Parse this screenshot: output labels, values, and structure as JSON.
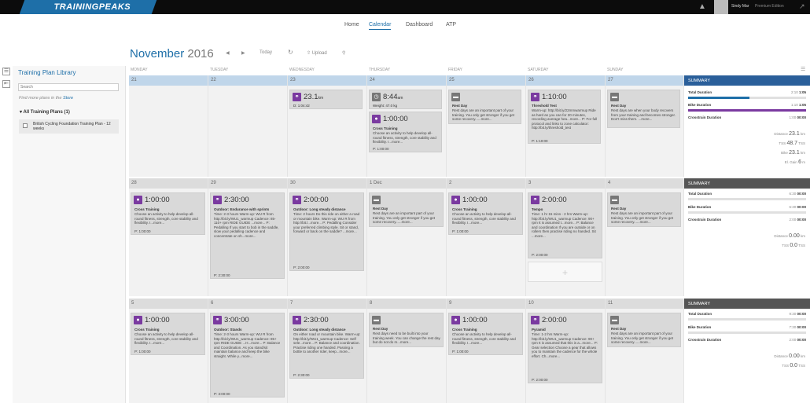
{
  "app": {
    "logo": "TRAININGPEAKS",
    "user": "Sindy Mar",
    "edition": "Premium Edition"
  },
  "nav": {
    "home": "Home",
    "calendar": "Calendar",
    "dashboard": "Dashboard",
    "atp": "ATP"
  },
  "header": {
    "month": "November",
    "year": "2016",
    "today": "Today",
    "upload": "Upload"
  },
  "library": {
    "title": "Training Plan Library",
    "search_placeholder": "Search",
    "find_text": "Find more plans in the ",
    "store_link": "Store",
    "all_plans": "All Training Plans (1)",
    "plan_name": "British Cycling Foundation Training Plan - 12 weeks"
  },
  "days": [
    "MONDAY",
    "TUESDAY",
    "WEDNESDAY",
    "THURSDAY",
    "FRIDAY",
    "SATURDAY",
    "SUNDAY"
  ],
  "weeks": [
    {
      "dates": [
        "21",
        "22",
        "23",
        "24",
        "25",
        "26",
        "27"
      ],
      "summary_title": "SUMMARY",
      "summary": {
        "total_label": "Total Duration",
        "total_val": "2:10",
        "total_plan": "1:05",
        "bike_label": "Bike Duration",
        "bike_val": "1:10",
        "bike_plan": "1:05",
        "cross_label": "Crosstrain Duration",
        "cross_val": "1:00",
        "cross_plan": "00:00",
        "distance_label": "Distance",
        "distance_val": "23.1",
        "distance_unit": "km",
        "tss_label": "TSS",
        "tss_val": "48.7",
        "tss_unit": "TSS",
        "bike_dist_label": "Bike",
        "bike_dist_val": "23.1",
        "bike_dist_unit": "km",
        "elev_label": "El. Gain",
        "elev_val": "6",
        "elev_unit": "m"
      },
      "cards": {
        "wed": {
          "dur": "23.1",
          "unit": "km",
          "sub": "D: 1:04:42"
        },
        "thu1": {
          "dur": "8:44",
          "unit": "am",
          "sub": "Weight: 47.0 kg"
        },
        "thu2": {
          "dur": "1:00:00",
          "title": "Cross Training",
          "desc": "Choose an activity to help develop all-round fitness, strength, core stability and flexibility. I...more...",
          "p": "P: 1:00:00"
        },
        "fri": {
          "title": "Rest Day",
          "desc": "Rest days are an important part of your training. You only get stronger if you get some recovery......more..."
        },
        "sat": {
          "dur": "1:10:00",
          "title": "Threshold Test",
          "desc": "Warm-up: http://bit.ly/22mmwarmup Ride as hard as you can for 20 minutes, recording average hea...more... P: For full protocol and links to zone calculator: http://bit.ly/threshold_test",
          "p": "P: 1:10:00"
        },
        "sun": {
          "title": "Rest Day",
          "desc": "Rest days are when your body recovers from your training and becomes stronger. Don't miss them. ...more..."
        }
      }
    },
    {
      "dates": [
        "28",
        "29",
        "30",
        "1 Dec",
        "2",
        "3",
        "4"
      ],
      "summary_title": "SUMMARY",
      "summary": {
        "total_label": "Total Duration",
        "total_val": "6:30",
        "total_plan": "00:00",
        "bike_label": "Bike Duration",
        "bike_val": "6:30",
        "bike_plan": "00:00",
        "cross_label": "Crosstrain Duration",
        "cross_val": "2:00",
        "cross_plan": "00:00",
        "distance_label": "Distance",
        "distance_val": "0.00",
        "distance_unit": "km",
        "tss_label": "TSS",
        "tss_val": "0.0",
        "tss_unit": "TSS"
      },
      "cards": {
        "mon": {
          "dur": "1:00:00",
          "title": "Cross Training",
          "desc": "Choose an activity to help develop all-round fitness, strength, core stability and flexibility. I...more...",
          "p": "P: 1:00:00"
        },
        "tue": {
          "dur": "2:30:00",
          "title": "Outdoor: Endurance with sprints",
          "desc": "Time: 2-3 hours Warm-up: WU R from http://bit.ly/WU1_warmup Cadence: 85-110+ rpm RIDE GUIDE ...more... P: Pedalling If you start to bob in the saddle, slow your pedalling cadence and concentrate on sh...more...",
          "p": "P: 2:30:00"
        },
        "wed": {
          "dur": "2:00:00",
          "title": "Outdoor: Long steady distance",
          "desc": "Time: 2 hours Do this ride on either a road or mountain bike. Warm-up: WU R from http://bit.l...more... P: Pedalling Consider your preferred climbing style. Sit or stand, forward or back on the saddle? ...more...",
          "p": "P: 2:00:00"
        },
        "thu": {
          "title": "Rest Day",
          "desc": "Rest days are an important part of your training. You only get stronger if you get some recovery......more..."
        },
        "fri": {
          "dur": "1:00:00",
          "title": "Cross Training",
          "desc": "Choose an activity to help develop all-round fitness, strength, core stability and flexibility. I...more...",
          "p": "P: 1:00:00"
        },
        "sat": {
          "dur": "2:00:00",
          "title": "Tempo",
          "desc": "Time: 1 hr 15 mins - 2 hrs Warm-up: http://bit.ly/WU1_warmup Cadence: 90+ rpm It is assumed t...more... P: Balance and coordination If you are outside or on rollers then practise riding no handed. Sit ...more...",
          "p": "P: 2:00:00"
        },
        "sun": {
          "title": "Rest Day",
          "desc": "Rest days are an important part of your training. You only get stronger if you get some recovery......more..."
        }
      }
    },
    {
      "dates": [
        "5",
        "6",
        "7",
        "8",
        "9",
        "10",
        "11"
      ],
      "summary_title": "SUMMARY",
      "summary": {
        "total_label": "Total Duration",
        "total_val": "9:30",
        "total_plan": "00:00",
        "bike_label": "Bike Duration",
        "bike_val": "7:30",
        "bike_plan": "00:00",
        "cross_label": "Crosstrain Duration",
        "cross_val": "2:00",
        "cross_plan": "00:00",
        "distance_label": "Distance",
        "distance_val": "0.00",
        "distance_unit": "km",
        "tss_label": "TSS",
        "tss_val": "0.0",
        "tss_unit": "TSS"
      },
      "cards": {
        "mon": {
          "dur": "1:00:00",
          "title": "Cross Training",
          "desc": "Choose an activity to help develop all-round fitness, strength, core stability and flexibility. I...more...",
          "p": "P: 1:00:00"
        },
        "tue": {
          "dur": "3:00:00",
          "title": "Outdoor: Stands",
          "desc": "Time: 2-3 hours Warm-up: WU R from http://bit.ly/WU1_warmup Cadence: 85+ rpm RIDE GUIDE ...H...more... P: Balance and Coordination. As you stand/sit maintain balance and keep the bike straight. While y...more...",
          "p": "P: 3:00:00"
        },
        "wed": {
          "dur": "2:30:00",
          "title": "Outdoor: Long steady distance",
          "desc": "On either road or mountain bike. Warm-up: http://bit.ly/WU1_warmup Cadence: Self sele...more... P: Balance and coordination. Practise riding one handed. Passing a bottle to another rider, keep...more...",
          "p": "P: 2:30:00"
        },
        "thu": {
          "title": "Rest Day",
          "desc": "Rest days need to be built into your training week. You can change the rest day but do not do m...more..."
        },
        "fri": {
          "dur": "1:00:00",
          "title": "Cross Training",
          "desc": "Choose an activity to help develop all-round fitness, strength, core stability and flexibility. I...more...",
          "p": "P: 1:00:00"
        },
        "sat": {
          "dur": "2:00:00",
          "title": "Pyramid",
          "desc": "Time: 1-2 hrs Warm-up: http://bit.ly/WU1_warmup Cadence: 90+ rpm It is assumed that this is a...more... P: Gear selection Choose a gear that allows you to maintain the cadence for the whole effort. Ch...more...",
          "p": "P: 2:00:00"
        },
        "sun": {
          "title": "Rest Day",
          "desc": "Rest days are an important part of your training. You only get stronger if you get some recovery......more..."
        }
      }
    }
  ],
  "colors": {
    "brand": "#1e6fa8",
    "purple": "#7a3aa0",
    "summary_current": "#2a5f9a",
    "summary_other": "#555555"
  }
}
